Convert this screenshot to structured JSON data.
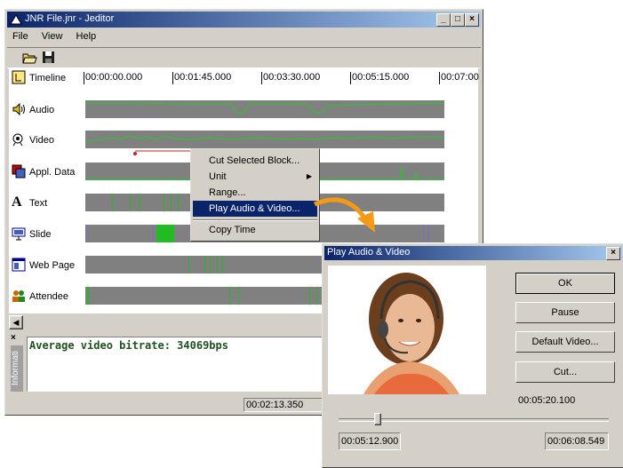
{
  "window": {
    "title": "JNR File.jnr - Jeditor",
    "menu": [
      "File",
      "View",
      "Help"
    ],
    "timeline_ticks": [
      "00:00:00.000",
      "00:01:45.000",
      "00:03:30.000",
      "00:05:15.000",
      "00:07:00"
    ],
    "rows": [
      {
        "label": "Timeline",
        "icon": "timeline-icon"
      },
      {
        "label": "Audio",
        "icon": "speaker-icon"
      },
      {
        "label": "Video",
        "icon": "camera-icon"
      },
      {
        "label": "Appl. Data",
        "icon": "application-icon"
      },
      {
        "label": "Text",
        "icon": "text-icon"
      },
      {
        "label": "Slide",
        "icon": "slide-icon"
      },
      {
        "label": "Web Page",
        "icon": "web-page-icon"
      },
      {
        "label": "Attendee",
        "icon": "attendee-icon"
      }
    ],
    "info_tab": "Informati",
    "info_text": "Average video bitrate: 34069bps",
    "status_time": "00:02:13.350"
  },
  "context_menu": {
    "items": [
      "Cut Selected Block...",
      "Unit",
      "Range...",
      "Play Audio & Video...",
      "Copy Time"
    ],
    "selected": "Play Audio & Video..."
  },
  "dialog": {
    "title": "Play Audio & Video",
    "close": "×",
    "buttons": {
      "ok": "OK",
      "pause": "Pause",
      "default_video": "Default Video...",
      "cut": "Cut..."
    },
    "current_time": "00:05:20.100",
    "start_time": "00:05:12.900",
    "end_time": "00:06:08.549"
  },
  "colors": {
    "titlebar": "#0a246a",
    "audio_wave": "#22bb22",
    "accent_arrow": "#f59a16"
  }
}
